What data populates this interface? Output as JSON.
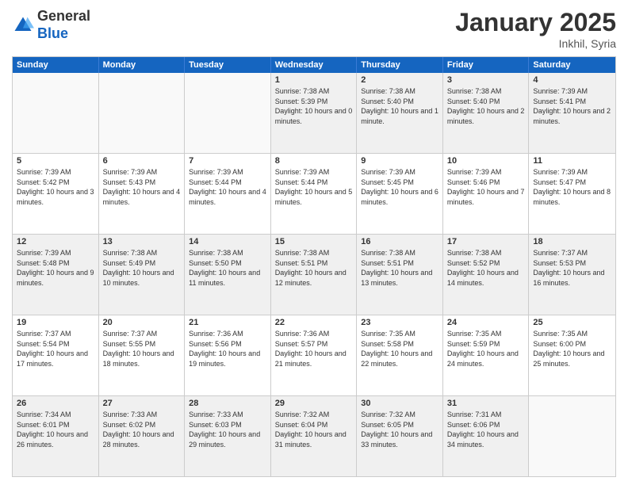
{
  "logo": {
    "general": "General",
    "blue": "Blue"
  },
  "header": {
    "month": "January 2025",
    "location": "Inkhil, Syria"
  },
  "weekdays": [
    "Sunday",
    "Monday",
    "Tuesday",
    "Wednesday",
    "Thursday",
    "Friday",
    "Saturday"
  ],
  "weeks": [
    [
      {
        "day": "",
        "empty": true
      },
      {
        "day": "",
        "empty": true
      },
      {
        "day": "",
        "empty": true
      },
      {
        "day": "1",
        "sunrise": "7:38 AM",
        "sunset": "5:39 PM",
        "daylight": "10 hours and 0 minutes."
      },
      {
        "day": "2",
        "sunrise": "7:38 AM",
        "sunset": "5:40 PM",
        "daylight": "10 hours and 1 minute."
      },
      {
        "day": "3",
        "sunrise": "7:38 AM",
        "sunset": "5:40 PM",
        "daylight": "10 hours and 2 minutes."
      },
      {
        "day": "4",
        "sunrise": "7:39 AM",
        "sunset": "5:41 PM",
        "daylight": "10 hours and 2 minutes."
      }
    ],
    [
      {
        "day": "5",
        "sunrise": "7:39 AM",
        "sunset": "5:42 PM",
        "daylight": "10 hours and 3 minutes."
      },
      {
        "day": "6",
        "sunrise": "7:39 AM",
        "sunset": "5:43 PM",
        "daylight": "10 hours and 4 minutes."
      },
      {
        "day": "7",
        "sunrise": "7:39 AM",
        "sunset": "5:44 PM",
        "daylight": "10 hours and 4 minutes."
      },
      {
        "day": "8",
        "sunrise": "7:39 AM",
        "sunset": "5:44 PM",
        "daylight": "10 hours and 5 minutes."
      },
      {
        "day": "9",
        "sunrise": "7:39 AM",
        "sunset": "5:45 PM",
        "daylight": "10 hours and 6 minutes."
      },
      {
        "day": "10",
        "sunrise": "7:39 AM",
        "sunset": "5:46 PM",
        "daylight": "10 hours and 7 minutes."
      },
      {
        "day": "11",
        "sunrise": "7:39 AM",
        "sunset": "5:47 PM",
        "daylight": "10 hours and 8 minutes."
      }
    ],
    [
      {
        "day": "12",
        "sunrise": "7:39 AM",
        "sunset": "5:48 PM",
        "daylight": "10 hours and 9 minutes."
      },
      {
        "day": "13",
        "sunrise": "7:38 AM",
        "sunset": "5:49 PM",
        "daylight": "10 hours and 10 minutes."
      },
      {
        "day": "14",
        "sunrise": "7:38 AM",
        "sunset": "5:50 PM",
        "daylight": "10 hours and 11 minutes."
      },
      {
        "day": "15",
        "sunrise": "7:38 AM",
        "sunset": "5:51 PM",
        "daylight": "10 hours and 12 minutes."
      },
      {
        "day": "16",
        "sunrise": "7:38 AM",
        "sunset": "5:51 PM",
        "daylight": "10 hours and 13 minutes."
      },
      {
        "day": "17",
        "sunrise": "7:38 AM",
        "sunset": "5:52 PM",
        "daylight": "10 hours and 14 minutes."
      },
      {
        "day": "18",
        "sunrise": "7:37 AM",
        "sunset": "5:53 PM",
        "daylight": "10 hours and 16 minutes."
      }
    ],
    [
      {
        "day": "19",
        "sunrise": "7:37 AM",
        "sunset": "5:54 PM",
        "daylight": "10 hours and 17 minutes."
      },
      {
        "day": "20",
        "sunrise": "7:37 AM",
        "sunset": "5:55 PM",
        "daylight": "10 hours and 18 minutes."
      },
      {
        "day": "21",
        "sunrise": "7:36 AM",
        "sunset": "5:56 PM",
        "daylight": "10 hours and 19 minutes."
      },
      {
        "day": "22",
        "sunrise": "7:36 AM",
        "sunset": "5:57 PM",
        "daylight": "10 hours and 21 minutes."
      },
      {
        "day": "23",
        "sunrise": "7:35 AM",
        "sunset": "5:58 PM",
        "daylight": "10 hours and 22 minutes."
      },
      {
        "day": "24",
        "sunrise": "7:35 AM",
        "sunset": "5:59 PM",
        "daylight": "10 hours and 24 minutes."
      },
      {
        "day": "25",
        "sunrise": "7:35 AM",
        "sunset": "6:00 PM",
        "daylight": "10 hours and 25 minutes."
      }
    ],
    [
      {
        "day": "26",
        "sunrise": "7:34 AM",
        "sunset": "6:01 PM",
        "daylight": "10 hours and 26 minutes."
      },
      {
        "day": "27",
        "sunrise": "7:33 AM",
        "sunset": "6:02 PM",
        "daylight": "10 hours and 28 minutes."
      },
      {
        "day": "28",
        "sunrise": "7:33 AM",
        "sunset": "6:03 PM",
        "daylight": "10 hours and 29 minutes."
      },
      {
        "day": "29",
        "sunrise": "7:32 AM",
        "sunset": "6:04 PM",
        "daylight": "10 hours and 31 minutes."
      },
      {
        "day": "30",
        "sunrise": "7:32 AM",
        "sunset": "6:05 PM",
        "daylight": "10 hours and 33 minutes."
      },
      {
        "day": "31",
        "sunrise": "7:31 AM",
        "sunset": "6:06 PM",
        "daylight": "10 hours and 34 minutes."
      },
      {
        "day": "",
        "empty": true
      }
    ]
  ]
}
